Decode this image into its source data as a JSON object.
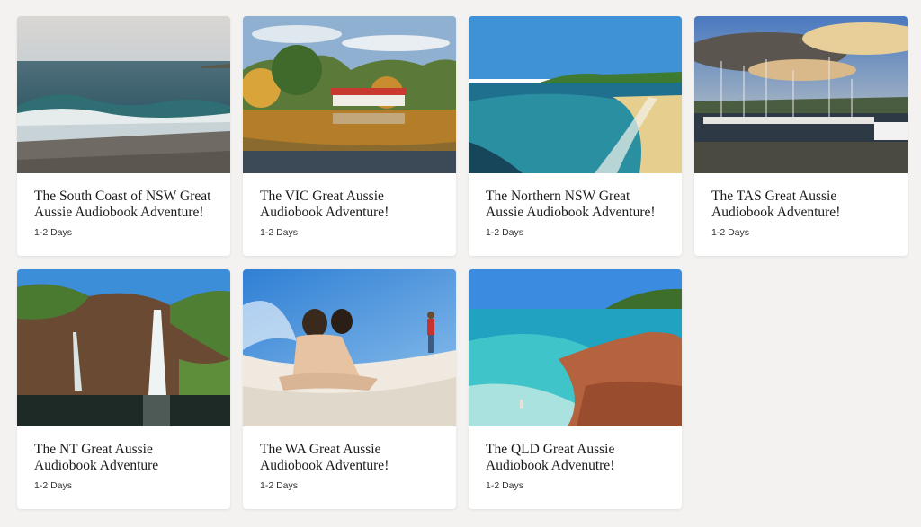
{
  "tours": [
    {
      "title": "The South Coast of NSW Great Aussie Audiobook Adventure!",
      "duration": "1-2 Days",
      "image": "surf-beach-photo"
    },
    {
      "title": "The VIC Great Aussie Audiobook Adventure!",
      "duration": "1-2 Days",
      "image": "lake-boathouse-photo"
    },
    {
      "title": "The Northern NSW Great Aussie Audiobook Adventure!",
      "duration": "1-2 Days",
      "image": "bay-beach-photo"
    },
    {
      "title": "The TAS Great Aussie Audiobook Adventure!",
      "duration": "1-2 Days",
      "image": "harbour-yachts-photo"
    },
    {
      "title": "The NT Great Aussie Audiobook Adventure",
      "duration": "1-2 Days",
      "image": "waterfall-gorge-photo"
    },
    {
      "title": "The WA Great Aussie Audiobook Adventure!",
      "duration": "1-2 Days",
      "image": "sand-dune-photo"
    },
    {
      "title": "The QLD Great Aussie Audiobook Advenutre!",
      "duration": "1-2 Days",
      "image": "tropical-cove-photo"
    }
  ]
}
